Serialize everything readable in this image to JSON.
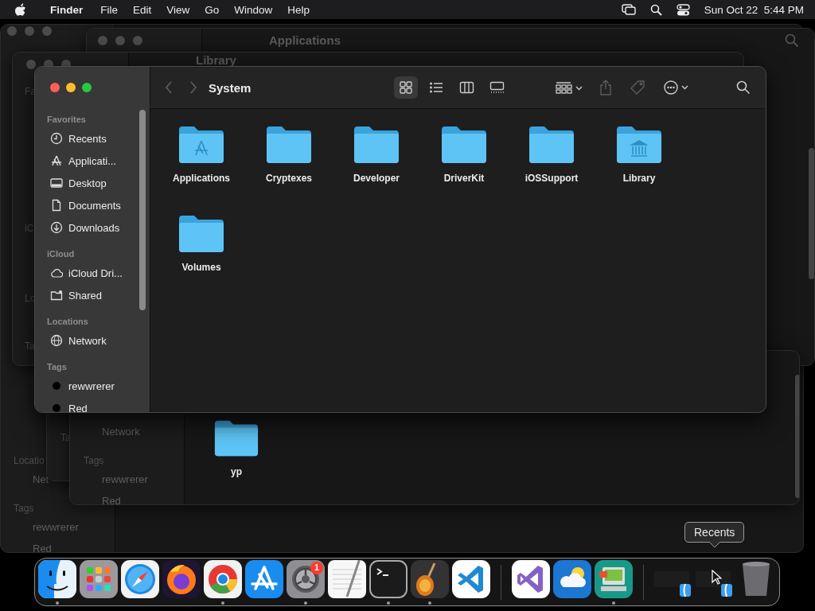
{
  "menu_bar": {
    "app_name": "Finder",
    "menus": [
      "File",
      "Edit",
      "View",
      "Go",
      "Window",
      "Help"
    ],
    "clock": "Sun Oct 22  5:44 PM"
  },
  "background_windows": [
    {
      "texts": [
        {
          "text": "Locatio",
          "kind": "heading"
        },
        {
          "text": "Net",
          "kind": "item"
        },
        {
          "text": "Tags",
          "kind": "heading"
        },
        {
          "text": "rewwrerer",
          "kind": "item"
        },
        {
          "text": "Red",
          "kind": "item"
        }
      ]
    },
    {
      "title": "Applications"
    },
    {
      "title": "Library",
      "texts": [
        {
          "text": "Fa",
          "kind": "heading"
        },
        {
          "text": "iC",
          "kind": "heading"
        },
        {
          "text": "Lo",
          "kind": "heading"
        },
        {
          "text": "Ta",
          "kind": "heading"
        }
      ]
    },
    {
      "texts": [
        {
          "text": "Ta",
          "kind": "heading"
        }
      ]
    },
    {
      "texts": [
        {
          "text": "Network",
          "kind": "item"
        },
        {
          "text": "Tags",
          "kind": "heading"
        },
        {
          "text": "rewwrerer",
          "kind": "item"
        },
        {
          "text": "Red",
          "kind": "item"
        }
      ],
      "items": [
        {
          "name": "yp"
        }
      ]
    }
  ],
  "window": {
    "title": "System",
    "view_modes": [
      {
        "selected": true
      },
      {
        "selected": false
      },
      {
        "selected": false
      },
      {
        "selected": false
      }
    ],
    "sidebar": [
      {
        "heading": "Favorites",
        "items": [
          {
            "label": "Recents",
            "kind": "place"
          },
          {
            "label": "Applicati...",
            "kind": "place"
          },
          {
            "label": "Desktop",
            "kind": "place"
          },
          {
            "label": "Documents",
            "kind": "place"
          },
          {
            "label": "Downloads",
            "kind": "place"
          }
        ]
      },
      {
        "heading": "iCloud",
        "items": [
          {
            "label": "iCloud Dri...",
            "kind": "place"
          },
          {
            "label": "Shared",
            "kind": "place"
          }
        ]
      },
      {
        "heading": "Locations",
        "items": [
          {
            "label": "Network",
            "kind": "place"
          }
        ]
      },
      {
        "heading": "Tags",
        "items": [
          {
            "label": "rewwrerer",
            "kind": "tag"
          },
          {
            "label": "Red",
            "kind": "tag"
          }
        ]
      }
    ],
    "items": [
      {
        "name": "Applications"
      },
      {
        "name": "Cryptexes"
      },
      {
        "name": "Developer"
      },
      {
        "name": "DriverKit"
      },
      {
        "name": "iOSSupport"
      },
      {
        "name": "Library"
      },
      {
        "name": "Volumes"
      }
    ]
  },
  "dock": {
    "groups": [
      {
        "items": [
          {
            "kind": "app",
            "running": true
          },
          {
            "kind": "app",
            "running": false
          },
          {
            "kind": "app",
            "running": false
          },
          {
            "kind": "app",
            "running": false
          },
          {
            "kind": "app",
            "running": true
          },
          {
            "kind": "app",
            "running": false
          },
          {
            "kind": "app",
            "running": true,
            "badge": "1"
          },
          {
            "kind": "app",
            "running": false
          },
          {
            "kind": "app",
            "running": true
          },
          {
            "kind": "app",
            "running": true
          },
          {
            "kind": "app",
            "running": false
          }
        ]
      },
      {
        "items": [
          {
            "kind": "app",
            "running": false
          },
          {
            "kind": "app",
            "running": false
          },
          {
            "kind": "app",
            "running": true
          }
        ]
      },
      {
        "items": [
          {
            "kind": "window"
          },
          {
            "kind": "window"
          },
          {
            "kind": "trash"
          }
        ]
      }
    ],
    "tooltip": "Recents"
  }
}
